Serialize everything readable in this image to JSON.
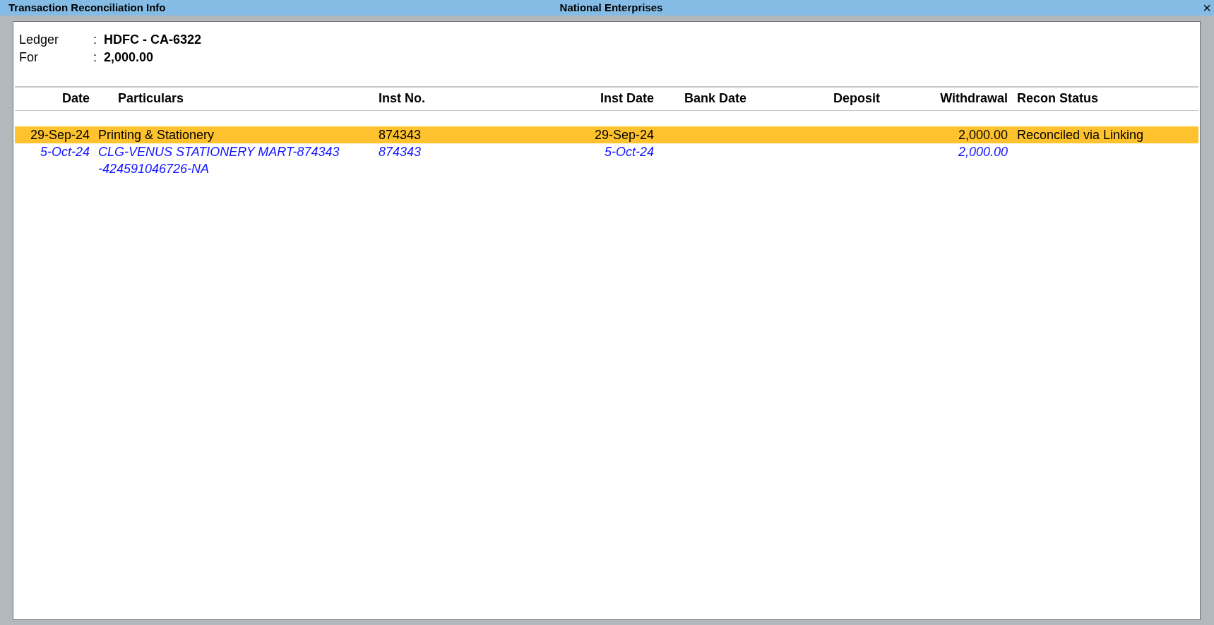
{
  "window": {
    "title": "Transaction Reconciliation Info",
    "company": "National Enterprises",
    "close": "×"
  },
  "details": [
    {
      "label": "Ledger",
      "separator": ":",
      "value": "HDFC - CA-6322"
    },
    {
      "label": "For",
      "separator": ":",
      "value": "2,000.00"
    }
  ],
  "table": {
    "columns": [
      "Date",
      "Particulars",
      "Inst No.",
      "Inst Date",
      "Bank Date",
      "Deposit",
      "Withdrawal",
      "Recon Status"
    ],
    "rows": [
      {
        "kind": "voucher",
        "selected": true,
        "cells": [
          "29-Sep-24",
          [
            "Printing & Stationery"
          ],
          "874343",
          "29-Sep-24",
          "",
          "",
          "2,000.00",
          "Reconciled via Linking"
        ]
      },
      {
        "kind": "bank",
        "selected": false,
        "cells": [
          "5-Oct-24",
          [
            "CLG-VENUS STATIONERY MART-874343",
            "-424591046726-NA"
          ],
          "874343",
          "5-Oct-24",
          "",
          "",
          "2,000.00",
          ""
        ]
      }
    ]
  }
}
